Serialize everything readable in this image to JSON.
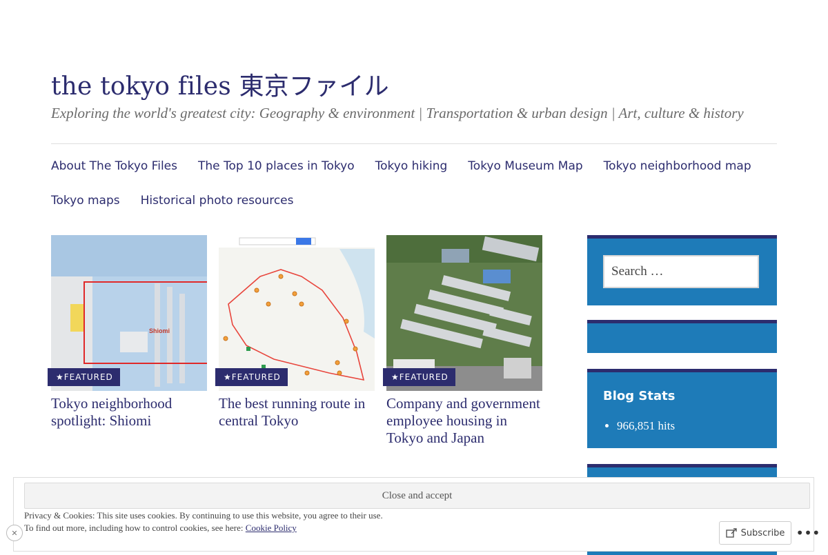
{
  "site": {
    "title": "the tokyo files 東京ファイル",
    "description": "Exploring the world's greatest city: Geography & environment | Transportation & urban design | Art, culture & history"
  },
  "nav": {
    "row1": [
      "About The Tokyo Files",
      "The Top 10 places in Tokyo",
      "Tokyo hiking",
      "Tokyo Museum Map",
      "Tokyo neighborhood map"
    ],
    "row2": [
      "Tokyo maps",
      "Historical photo resources"
    ]
  },
  "posts": [
    {
      "badge": "★FEATURED",
      "title": "Tokyo neighborhood spotlight: Shiomi",
      "thumb_icon": "map-thumbnail",
      "map_label": "Shiomi"
    },
    {
      "badge": "★FEATURED",
      "title": "The best running route in central Tokyo",
      "thumb_icon": "route-map-thumbnail"
    },
    {
      "badge": "★FEATURED",
      "title": "Company and government employee housing in Tokyo and Japan",
      "thumb_icon": "aerial-photo-thumbnail"
    }
  ],
  "sidebar": {
    "search_placeholder": "Search …",
    "stats_title": "Blog Stats",
    "hits": "966,851 hits"
  },
  "cookie": {
    "button": "Close and accept",
    "line1": "Privacy & Cookies: This site uses cookies. By continuing to use this website, you agree to their use.",
    "line2_prefix": "To find out more, including how to control cookies, see here: ",
    "link": "Cookie Policy"
  },
  "actions": {
    "subscribe": "Subscribe",
    "more": "•••"
  },
  "colors": {
    "accent": "#2c2c6e",
    "sidebar_blue": "#1e7bb8",
    "map_route": "#e8453c"
  }
}
